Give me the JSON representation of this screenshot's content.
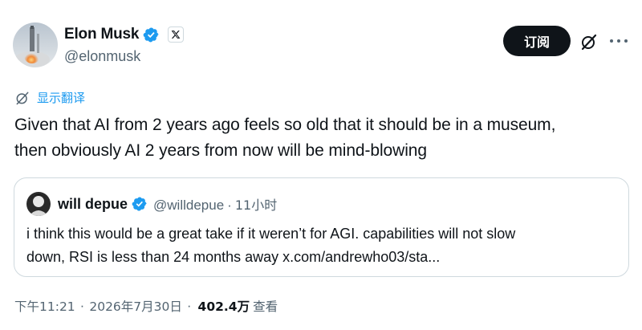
{
  "author": {
    "name": "Elon Musk",
    "handle": "@elonmusk"
  },
  "header": {
    "subscribe_label": "订阅"
  },
  "translate": {
    "label": "显示翻译"
  },
  "tweet": {
    "text_line1": "Given that AI from 2 years ago feels so old that it should be in a museum,",
    "text_line2": "then obviously AI 2 years from now will be mind-blowing"
  },
  "quote": {
    "name": "will depue",
    "handle": "@willdepue",
    "separator": "·",
    "time": "11小时",
    "text_line1": "i think this would be a great take if it weren’t for AGI. capabilities will not slow",
    "text_line2": "down, RSI is less than 24 months away x.com/andrewho03/sta..."
  },
  "footer": {
    "time": "下午11:21",
    "separator1": "·",
    "date": "2026年7月30日",
    "separator2": "·",
    "views_count": "402.4万",
    "views_label": "查看"
  },
  "colors": {
    "accent": "#1d9bf0",
    "text": "#0f1419",
    "muted": "#536471",
    "border": "#cfd9de"
  },
  "icons": [
    "verified-badge-icon",
    "x-logo-icon",
    "grok-slash-icon",
    "more-dots-icon",
    "translate-globe-icon"
  ]
}
